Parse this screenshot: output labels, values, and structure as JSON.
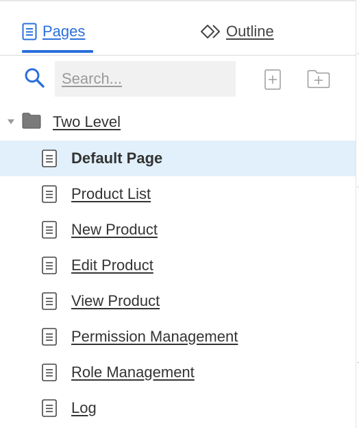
{
  "tabs": [
    {
      "label": "Pages",
      "active": true,
      "icon": "page-icon"
    },
    {
      "label": "Outline",
      "active": false,
      "icon": "outline-diamond-icon"
    }
  ],
  "toolbar": {
    "search_placeholder": "Search...",
    "add_page_icon": "add-page-icon",
    "add_folder_icon": "add-folder-icon"
  },
  "tree": {
    "folder": {
      "label": "Two Level",
      "expanded": true,
      "icon": "folder-icon"
    },
    "pages": [
      {
        "label": "Default Page",
        "selected": true
      },
      {
        "label": "Product List",
        "selected": false
      },
      {
        "label": "New Product",
        "selected": false
      },
      {
        "label": "Edit Product",
        "selected": false
      },
      {
        "label": "View Product",
        "selected": false
      },
      {
        "label": "Permission Management",
        "selected": false
      },
      {
        "label": "Role Management",
        "selected": false
      },
      {
        "label": "Log",
        "selected": false
      }
    ]
  },
  "colors": {
    "accent": "#2a6fdb",
    "selected_row": "#e1f0fb",
    "text": "#333333",
    "search_bg": "#f1f1f1"
  }
}
